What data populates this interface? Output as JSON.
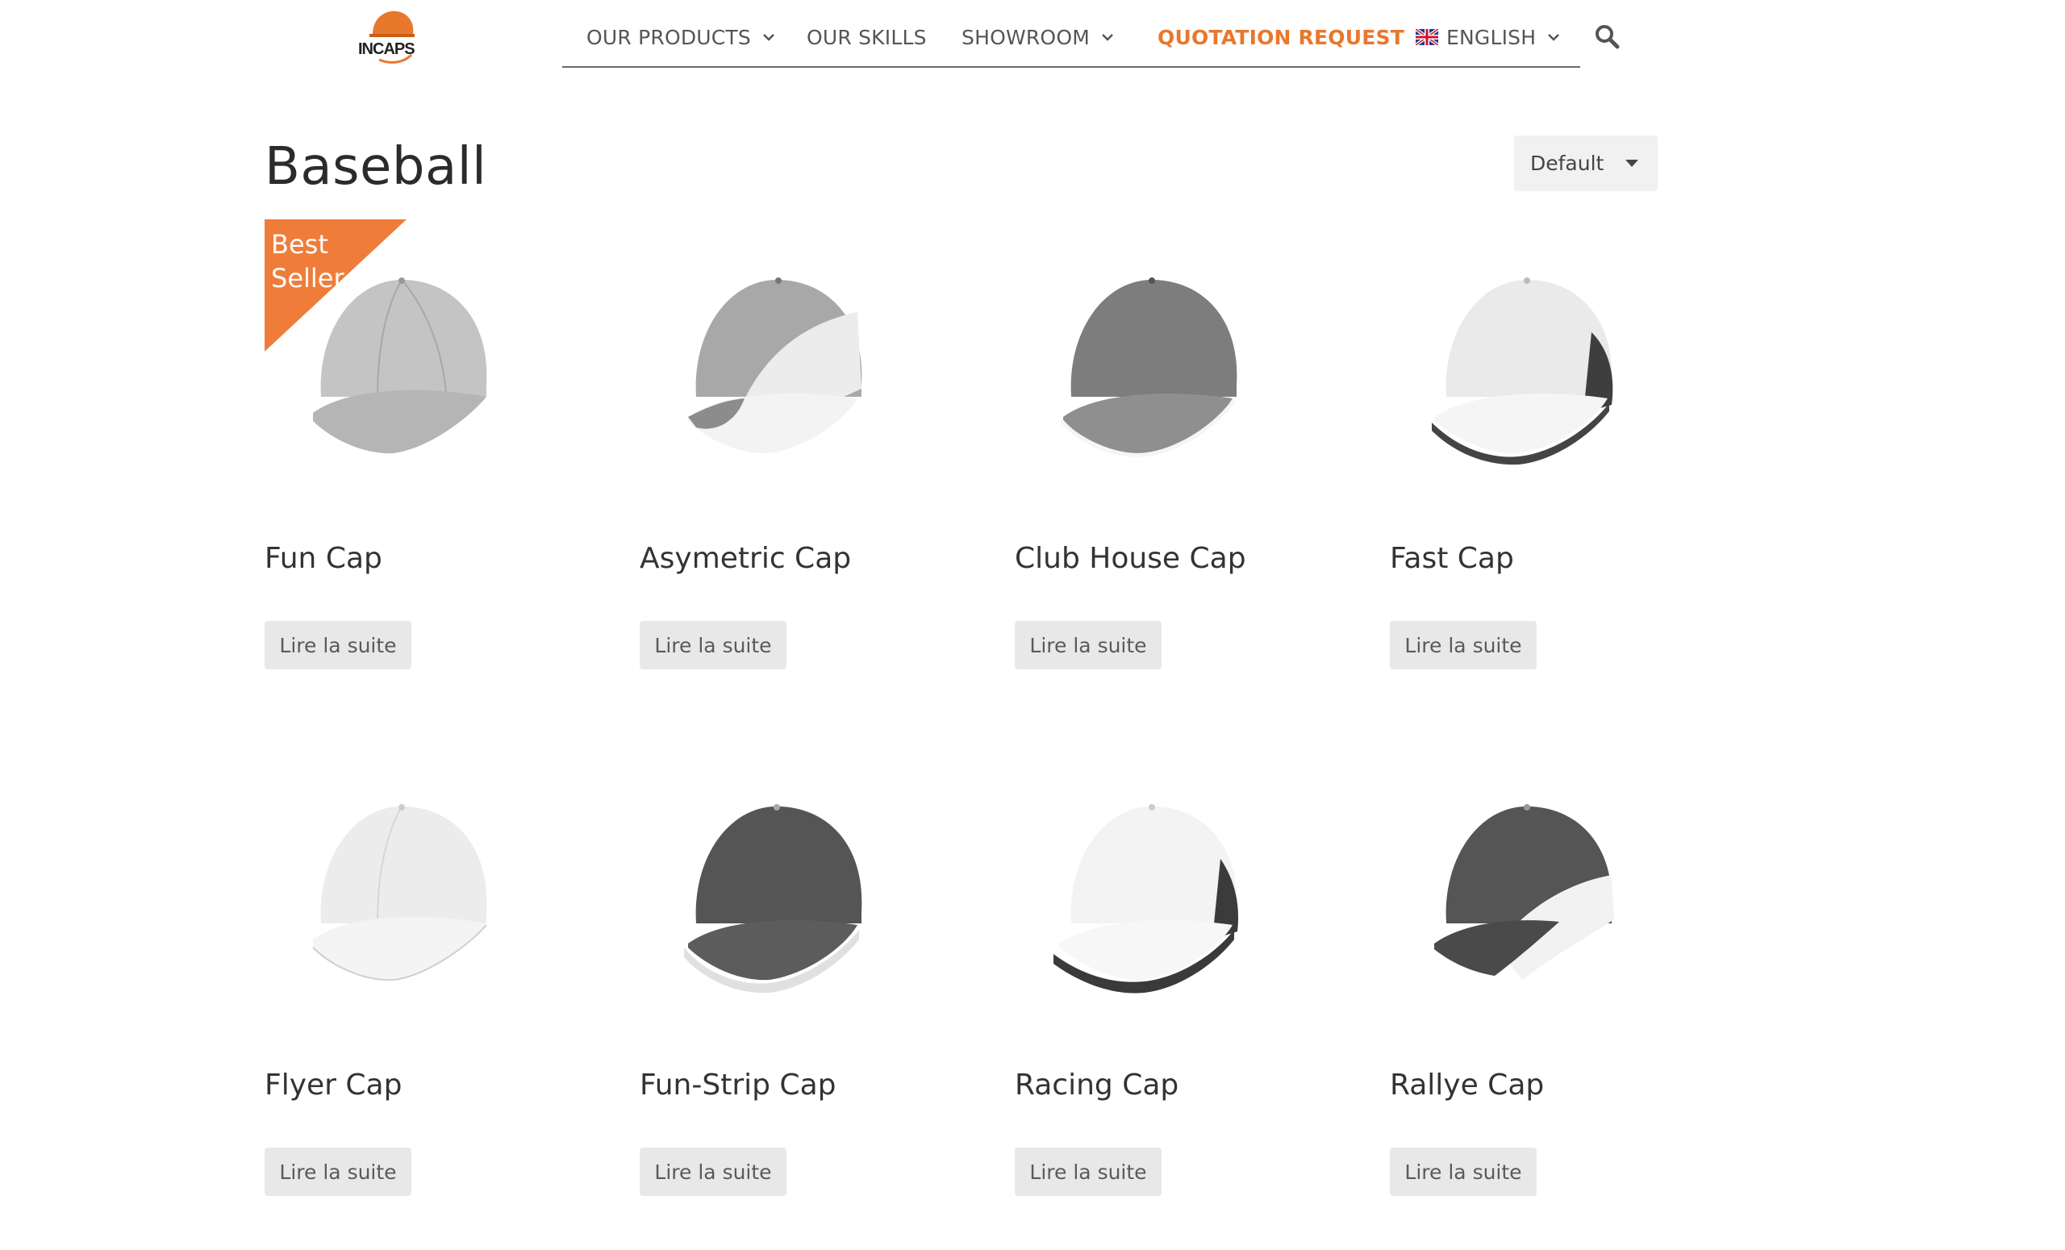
{
  "header": {
    "logo_text": "INCAPS",
    "nav": {
      "products": "OUR PRODUCTS",
      "skills": "OUR SKILLS",
      "showroom": "SHOWROOM",
      "quotation": "QUOTATION REQUEST",
      "language": "ENGLISH"
    },
    "accent_color": "#e8782c"
  },
  "page": {
    "title": "Baseball",
    "sort_value": "Default"
  },
  "products": [
    {
      "name": "Fun Cap",
      "button": "Lire la suite",
      "badge_line1": "Best",
      "badge_line2": "Seller"
    },
    {
      "name": "Asymetric Cap",
      "button": "Lire la suite"
    },
    {
      "name": "Club House Cap",
      "button": "Lire la suite"
    },
    {
      "name": "Fast Cap",
      "button": "Lire la suite"
    },
    {
      "name": "Flyer Cap",
      "button": "Lire la suite"
    },
    {
      "name": "Fun-Strip Cap",
      "button": "Lire la suite"
    },
    {
      "name": "Racing Cap",
      "button": "Lire la suite"
    },
    {
      "name": "Rallye Cap",
      "button": "Lire la suite"
    }
  ]
}
